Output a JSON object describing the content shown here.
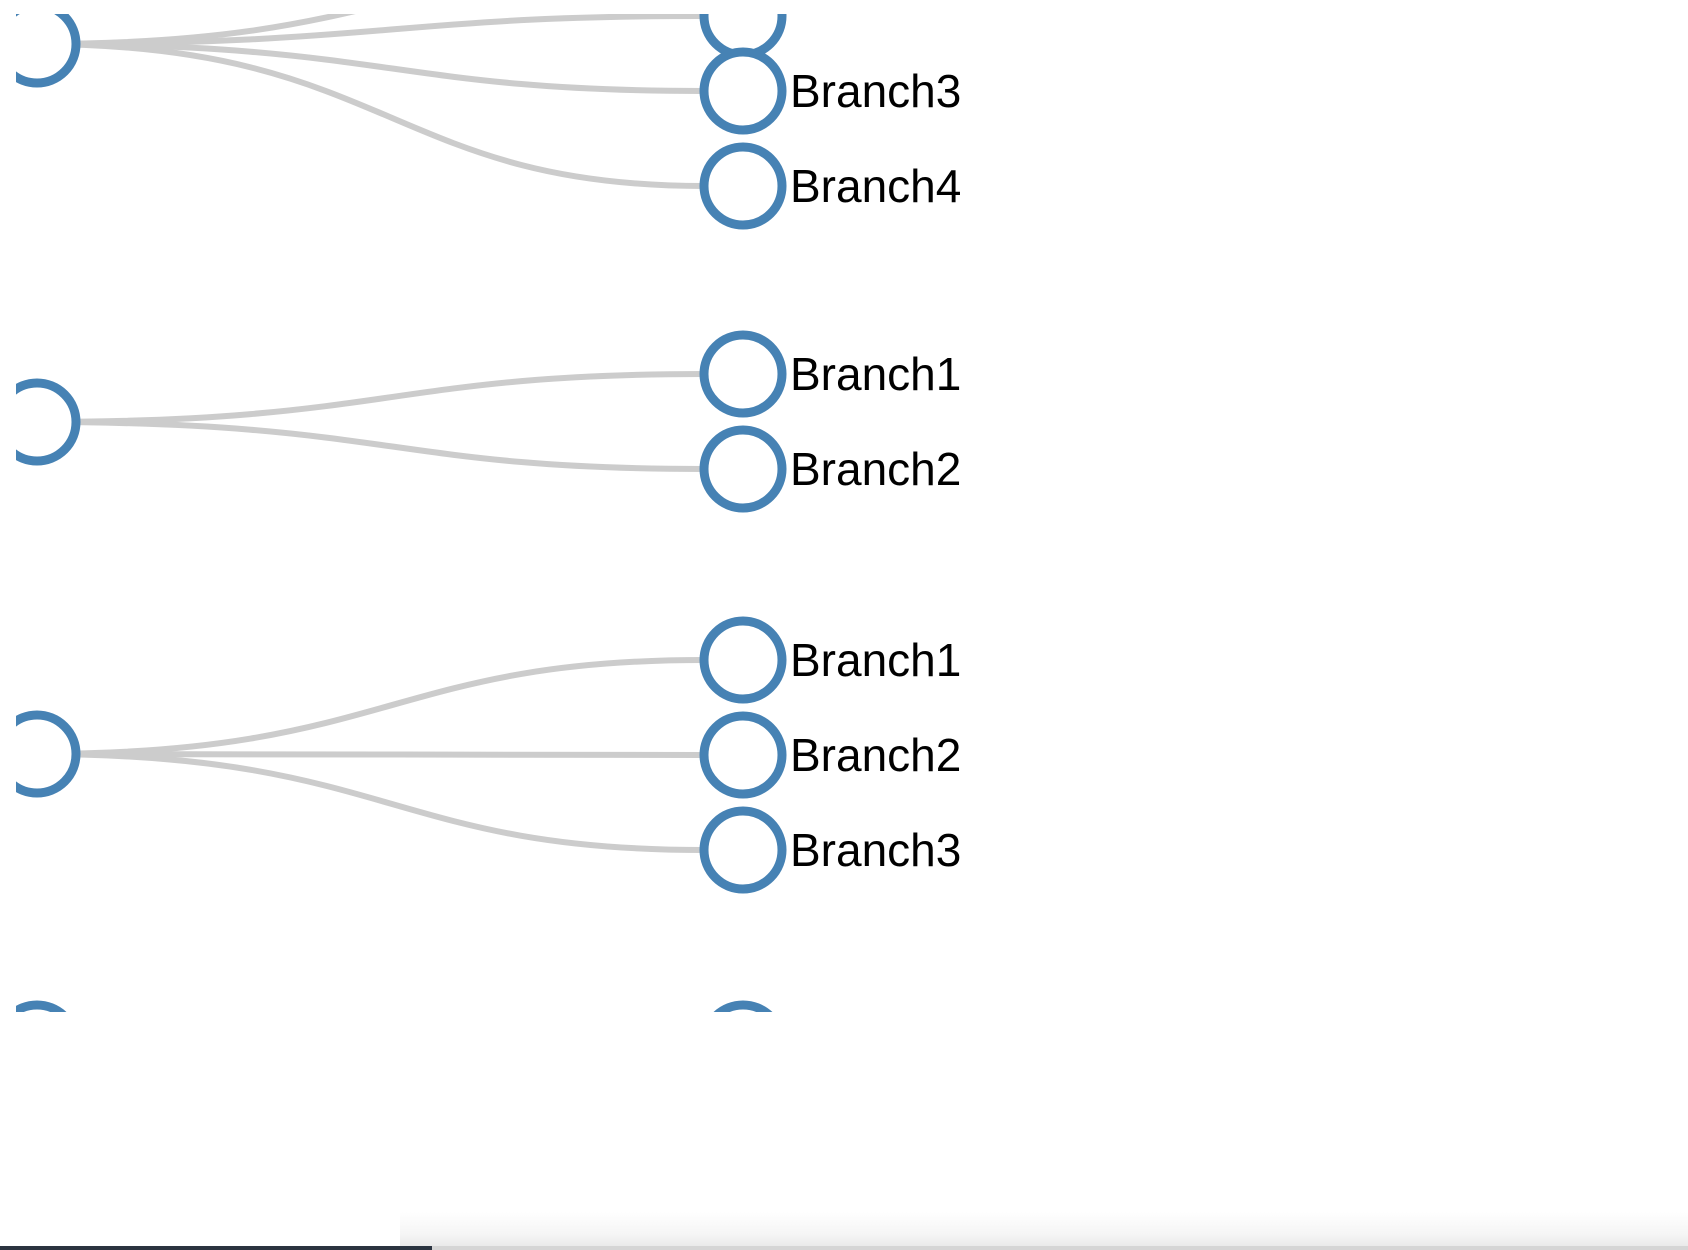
{
  "colors": {
    "node_stroke": "#4682b4",
    "node_fill": "#ffffff",
    "link_stroke": "#cccccc",
    "label": "#000000"
  },
  "groups": [
    {
      "children": [
        {
          "label": ""
        },
        {
          "label": ""
        },
        {
          "label": "Branch3"
        },
        {
          "label": "Branch4"
        }
      ]
    },
    {
      "children": [
        {
          "label": "Branch1"
        },
        {
          "label": "Branch2"
        }
      ]
    },
    {
      "children": [
        {
          "label": "Branch1"
        },
        {
          "label": "Branch2"
        },
        {
          "label": "Branch3"
        }
      ]
    },
    {
      "children": [
        {
          "label": ""
        }
      ]
    }
  ]
}
